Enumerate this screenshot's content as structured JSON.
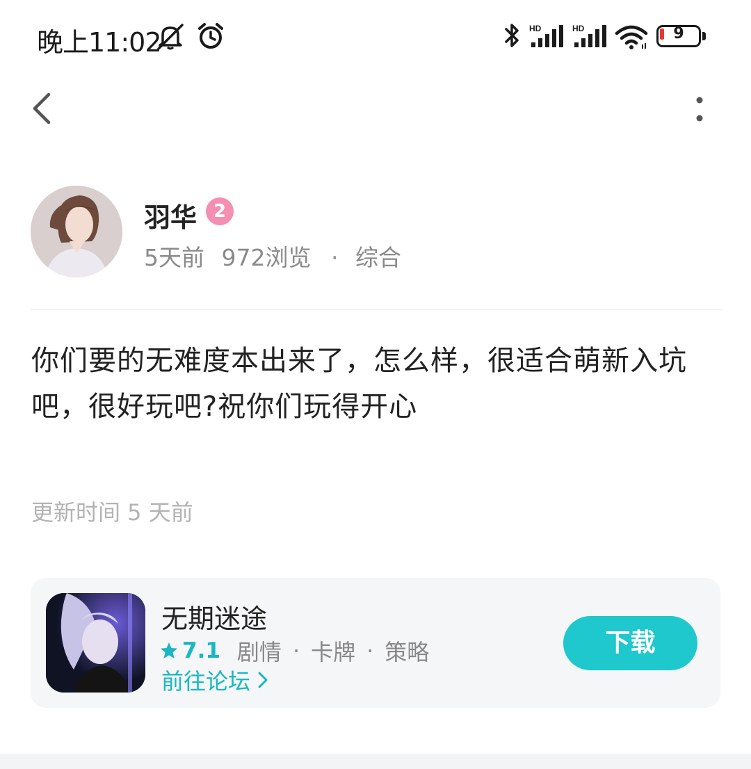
{
  "status_bar": {
    "time": "晚上11:02",
    "battery_level": "9",
    "icons": [
      "bell-muted-icon",
      "alarm-icon",
      "bluetooth-icon",
      "signal-hd-icon",
      "signal-hd-icon",
      "wifi-icon",
      "battery-icon"
    ],
    "network_label_1": "HD",
    "network_label_2": "HD"
  },
  "nav": {
    "back_icon": "chevron-left-icon",
    "more_icon": "more-vertical-icon"
  },
  "post": {
    "author": {
      "name": "羽华",
      "level": "2",
      "level_color": "#f48fb1"
    },
    "meta": {
      "time_ago": "5天前",
      "views": "972浏览",
      "separator": "·",
      "category": "综合"
    },
    "body": "你们要的无难度本出来了，怎么样，很适合萌新入坑吧，很好玩吧?祝你们玩得开心",
    "update_time": "更新时间 5 天前"
  },
  "game_card": {
    "name": "无期迷途",
    "rating": "7.1",
    "tags": [
      "剧情",
      "卡牌",
      "策略"
    ],
    "separator": "·",
    "forum_link": "前往论坛",
    "download_label": "下载",
    "accent_color": "#19b7c1",
    "button_color": "#1ec8cc"
  }
}
